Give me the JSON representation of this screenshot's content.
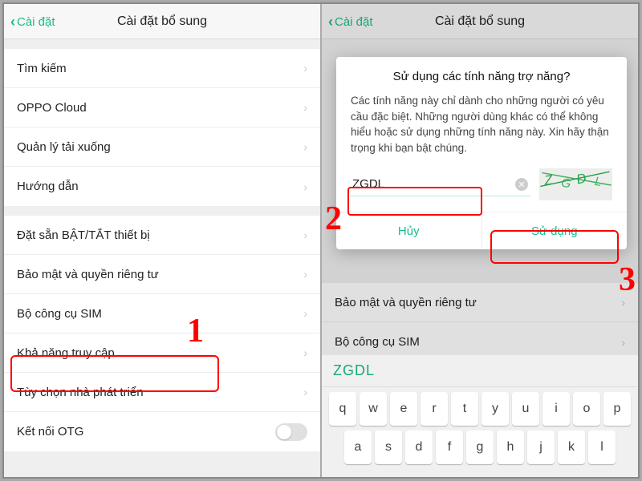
{
  "left": {
    "back": "Cài đặt",
    "title": "Cài đặt bổ sung",
    "g1": [
      "Tìm kiếm",
      "OPPO Cloud",
      "Quản lý tải xuống",
      "Hướng dẫn"
    ],
    "g2": [
      "Đặt sẵn BẬT/TẮT thiết bị",
      "Bảo mật và quyền riêng tư",
      "Bộ công cụ SIM",
      "Khả năng truy cập",
      "Tùy chọn nhà phát triển",
      "Kết nối OTG"
    ],
    "annot1": "1"
  },
  "right": {
    "back": "Cài đặt",
    "title": "Cài đặt bổ sung",
    "bg_g2": [
      "Bảo mật và quyền riêng tư",
      "Bộ công cụ SIM"
    ],
    "dialog": {
      "title": "Sử dụng các tính năng trợ năng?",
      "body": "Các tính năng này chỉ dành cho những người có yêu cầu đặc biệt. Những người dùng khác có thể không hiểu hoặc sử dụng những tính năng này. Xin hãy thận trọng khi bạn bật chúng.",
      "input_value": "ZGDL",
      "cancel": "Hủy",
      "confirm": "Sử dụng"
    },
    "annot2": "2",
    "annot3": "3",
    "kb": {
      "suggest": "ZGDL",
      "row1": [
        "q",
        "w",
        "e",
        "r",
        "t",
        "y",
        "u",
        "i",
        "o",
        "p"
      ],
      "row2": [
        "a",
        "s",
        "d",
        "f",
        "g",
        "h",
        "j",
        "k",
        "l"
      ]
    }
  }
}
